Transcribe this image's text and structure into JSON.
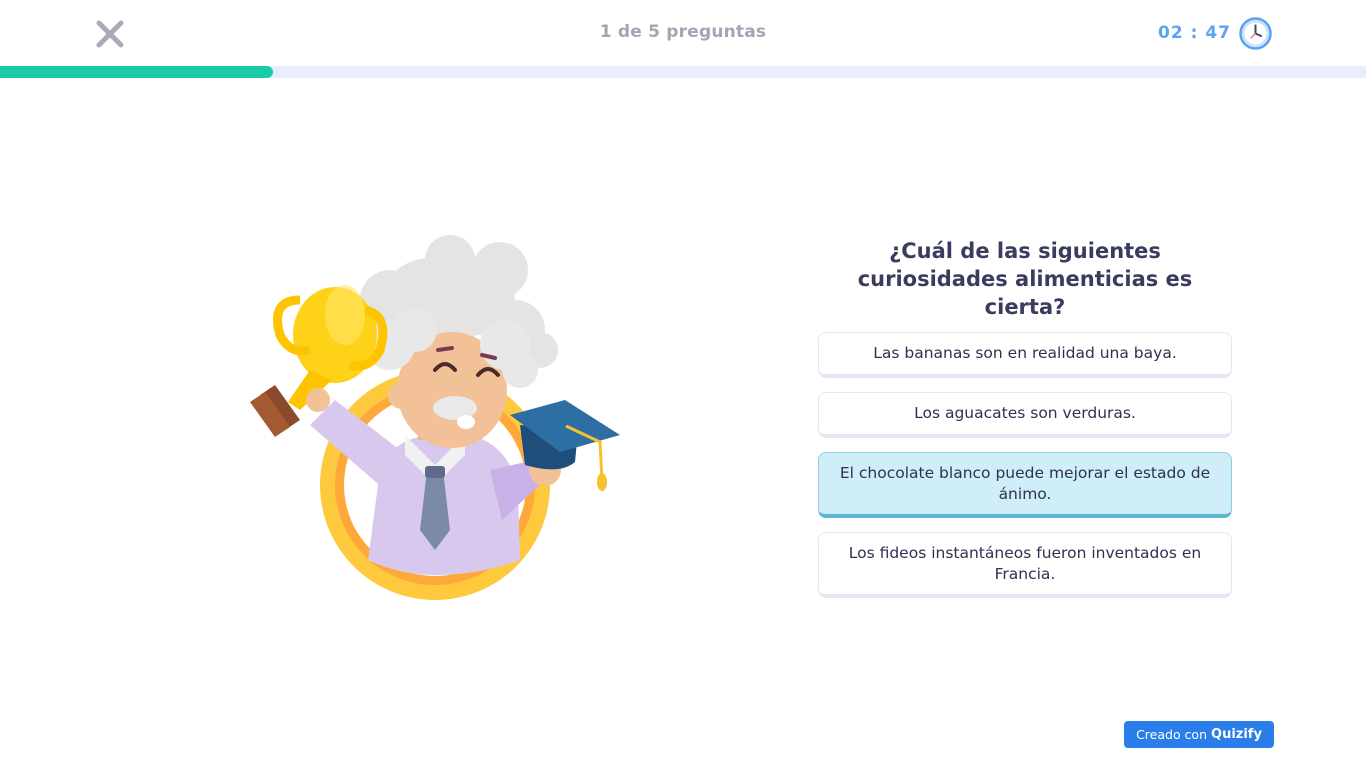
{
  "header": {
    "close_icon": "close-icon",
    "progress_label": "1 de 5 preguntas",
    "timer": "02 : 47",
    "timer_icon": "clock-icon",
    "progress_fraction": 0.2
  },
  "colors": {
    "accent_progress": "#1ccaa8",
    "timer_blue": "#5aa3f0",
    "selected_option_bg": "#cfeef8",
    "badge_blue": "#2b7de9"
  },
  "illustration": {
    "icon": "professor-with-trophy-illustration"
  },
  "question": {
    "text": "¿Cuál de las siguientes curiosidades alimenticias es cierta?"
  },
  "options": [
    {
      "label": "Las bananas son en realidad una baya.",
      "selected": false
    },
    {
      "label": "Los aguacates son verduras.",
      "selected": false
    },
    {
      "label": "El chocolate blanco puede mejorar el estado de ánimo.",
      "selected": true
    },
    {
      "label": "Los fideos instantáneos fueron inventados en Francia.",
      "selected": false
    }
  ],
  "footer": {
    "badge_prefix": "Creado con",
    "badge_brand": "Quizify"
  }
}
